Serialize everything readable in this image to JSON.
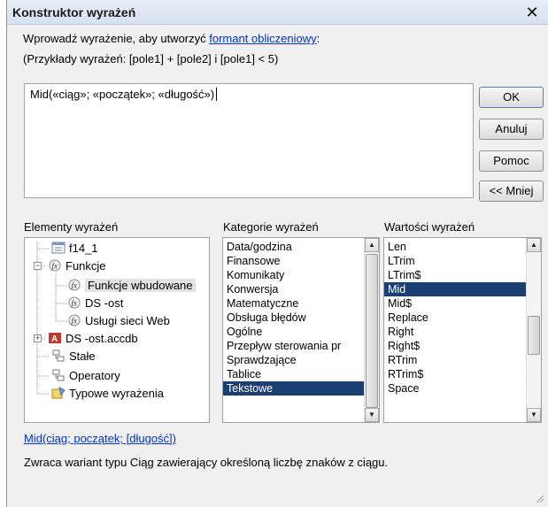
{
  "window": {
    "title": "Konstruktor wyrażeń"
  },
  "instructions": {
    "line1_prefix": "Wprowadź wyrażenie, aby utworzyć ",
    "line1_link": "formant obliczeniowy",
    "line1_suffix": ":",
    "line2": "(Przykłady wyrażeń: [pole1] + [pole2] i [pole1] < 5)"
  },
  "expression": {
    "value": "Mid(«ciąg»; «początek»; «długość»)"
  },
  "buttons": {
    "ok": "OK",
    "cancel": "Anuluj",
    "help": "Pomoc",
    "less": "<< Mniej"
  },
  "elements_pane": {
    "label": "Elementy wyrażeń",
    "items": [
      {
        "label": "f14_1"
      },
      {
        "label": "Funkcje"
      },
      {
        "label": "Funkcje wbudowane"
      },
      {
        "label": "DS -ost"
      },
      {
        "label": "Usługi sieci Web"
      },
      {
        "label": "DS -ost.accdb"
      },
      {
        "label": "Stałe"
      },
      {
        "label": "Operatory"
      },
      {
        "label": "Typowe wyrażenia"
      }
    ]
  },
  "categories_pane": {
    "label": "Kategorie wyrażeń",
    "items": [
      "Data/godzina",
      "Finansowe",
      "Komunikaty",
      "Konwersja",
      "Matematyczne",
      "Obsługa błędów",
      "Ogólne",
      "Przepływ sterowania pr",
      "Sprawdzające",
      "Tablice",
      "Tekstowe"
    ],
    "selected": "Tekstowe"
  },
  "values_pane": {
    "label": "Wartości wyrażeń",
    "items": [
      "Len",
      "LTrim",
      "LTrim$",
      "Mid",
      "Mid$",
      "Replace",
      "Right",
      "Right$",
      "RTrim",
      "RTrim$",
      "Space"
    ],
    "selected": "Mid"
  },
  "function_info": {
    "syntax": "Mid(ciąg; początek; [długość])",
    "description": "Zwraca wariant typu Ciąg zawierający określoną liczbę znaków z ciągu."
  }
}
